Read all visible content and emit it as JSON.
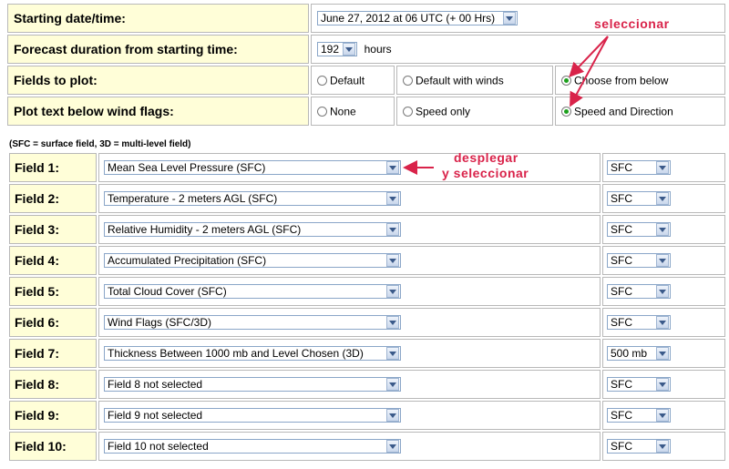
{
  "top_rows": {
    "start": {
      "label": "Starting date/time:",
      "value": "June 27, 2012 at 06 UTC (+ 00 Hrs)"
    },
    "duration": {
      "label": "Forecast duration from starting time:",
      "value": "192",
      "unit": "hours"
    },
    "fields_to_plot": {
      "label": "Fields to plot:",
      "options": [
        "Default",
        "Default with winds",
        "Choose from below"
      ],
      "selected": "Choose from below"
    },
    "plot_text": {
      "label": "Plot text below wind flags:",
      "options": [
        "None",
        "Speed only",
        "Speed and Direction"
      ],
      "selected": "Speed and Direction"
    }
  },
  "note": "(SFC = surface field, 3D = multi-level field)",
  "fields": [
    {
      "label": "Field 1:",
      "value": "Mean Sea Level Pressure (SFC)",
      "level": "SFC"
    },
    {
      "label": "Field 2:",
      "value": "Temperature - 2 meters AGL (SFC)",
      "level": "SFC"
    },
    {
      "label": "Field 3:",
      "value": "Relative Humidity - 2 meters AGL (SFC)",
      "level": "SFC"
    },
    {
      "label": "Field 4:",
      "value": "Accumulated Precipitation (SFC)",
      "level": "SFC"
    },
    {
      "label": "Field 5:",
      "value": "Total Cloud Cover (SFC)",
      "level": "SFC"
    },
    {
      "label": "Field 6:",
      "value": "Wind Flags (SFC/3D)",
      "level": "SFC"
    },
    {
      "label": "Field 7:",
      "value": "Thickness Between 1000 mb and Level Chosen (3D)",
      "level": "500 mb"
    },
    {
      "label": "Field 8:",
      "value": "Field 8 not selected",
      "level": "SFC"
    },
    {
      "label": "Field 9:",
      "value": "Field 9 not selected",
      "level": "SFC"
    },
    {
      "label": "Field 10:",
      "value": "Field 10 not selected",
      "level": "SFC"
    }
  ],
  "annotations": {
    "seleccionar": "seleccionar",
    "desplegar_1": "desplegar",
    "desplegar_2": "y seleccionar"
  },
  "colors": {
    "label_bg": "#fffed8",
    "annotation": "#d9234a",
    "radio_on": "#1ca01c"
  }
}
